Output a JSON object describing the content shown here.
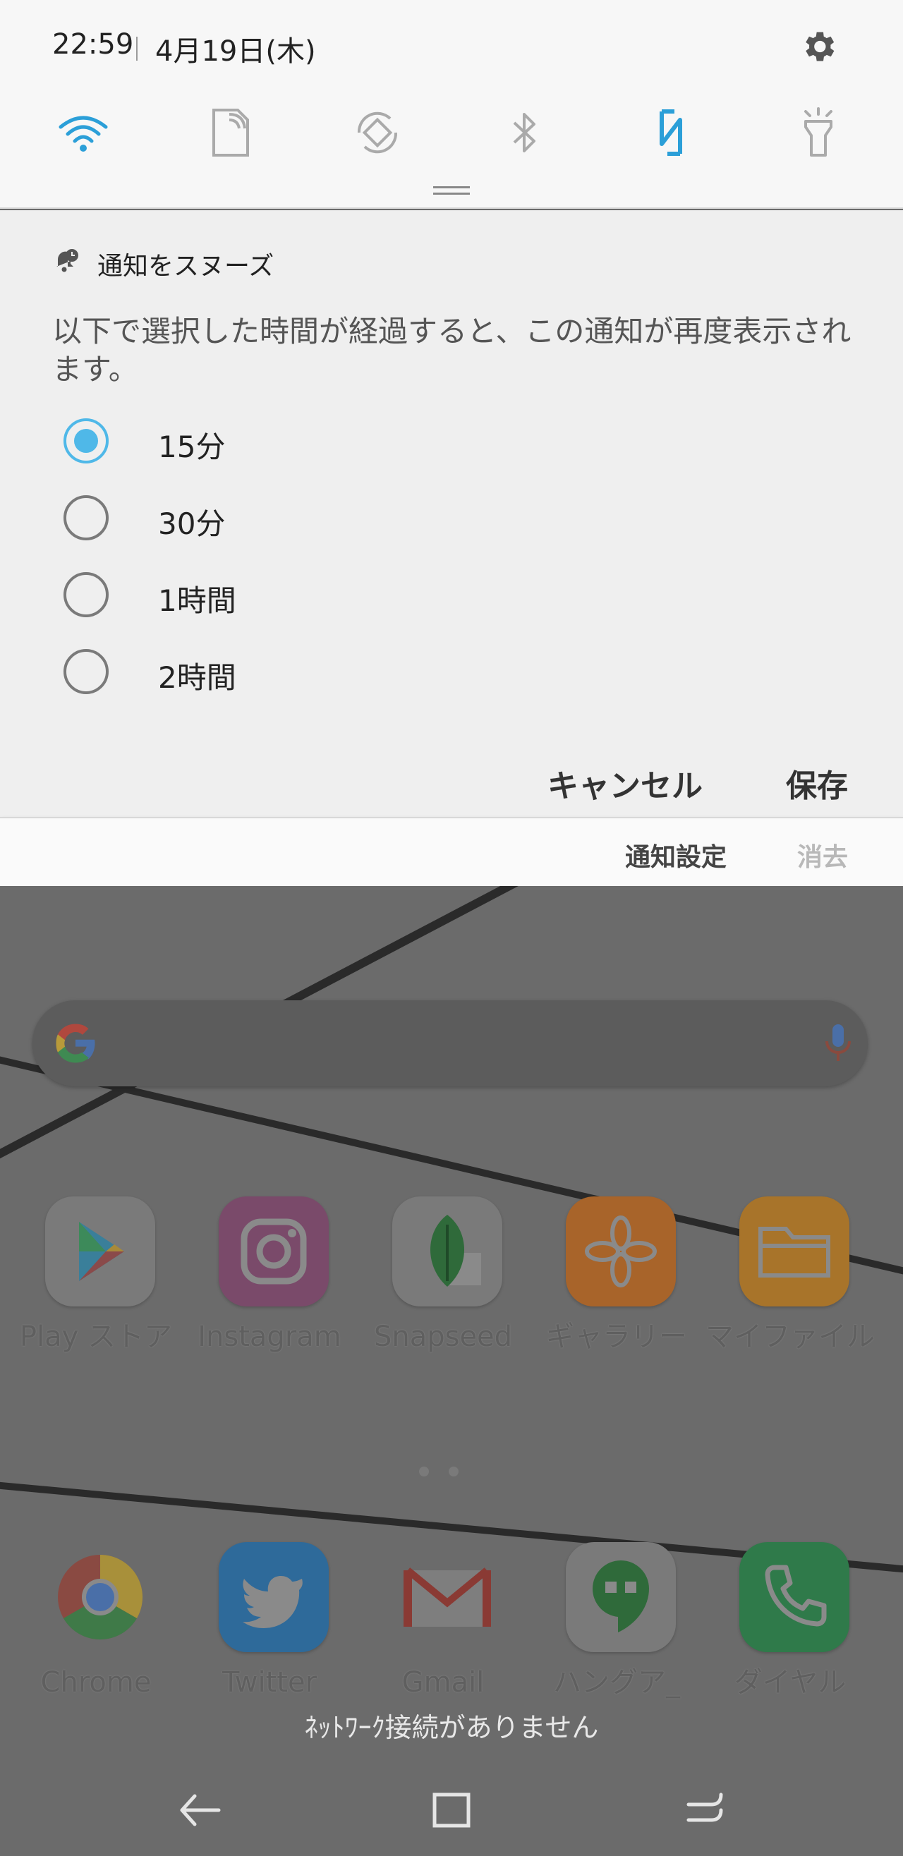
{
  "status": {
    "time": "22:59",
    "date": "4月19日(木)"
  },
  "quick_tiles": [
    {
      "name": "wifi-tile",
      "icon": "wifi-icon",
      "active": true
    },
    {
      "name": "mobile-data-tile",
      "icon": "sim-card-icon",
      "active": false
    },
    {
      "name": "auto-rotate-tile",
      "icon": "rotate-icon",
      "active": false
    },
    {
      "name": "bluetooth-tile",
      "icon": "bluetooth-icon",
      "active": false
    },
    {
      "name": "nfc-tile",
      "icon": "nfc-icon",
      "active": true
    },
    {
      "name": "flashlight-tile",
      "icon": "flashlight-icon",
      "active": false
    }
  ],
  "snooze": {
    "title": "通知をスヌーズ",
    "description": "以下で選択した時間が経過すると、この通知が再度表示されます。",
    "options": [
      {
        "label": "15分",
        "selected": true
      },
      {
        "label": "30分",
        "selected": false
      },
      {
        "label": "1時間",
        "selected": false
      },
      {
        "label": "2時間",
        "selected": false
      }
    ],
    "cancel_label": "キャンセル",
    "save_label": "保存"
  },
  "notification_footer": {
    "settings_label": "通知設定",
    "clear_label": "消去"
  },
  "home": {
    "apps_row1": [
      {
        "label": "Play ストア",
        "icon": "play-store-icon"
      },
      {
        "label": "Instagram",
        "icon": "instagram-icon"
      },
      {
        "label": "Snapseed",
        "icon": "snapseed-icon"
      },
      {
        "label": "ギャラリー",
        "icon": "gallery-icon"
      },
      {
        "label": "マイファイル",
        "icon": "my-files-icon"
      }
    ],
    "apps_row2": [
      {
        "label": "Chrome",
        "icon": "chrome-icon"
      },
      {
        "label": "Twitter",
        "icon": "twitter-icon"
      },
      {
        "label": "Gmail",
        "icon": "gmail-icon"
      },
      {
        "label": "ハングア_",
        "icon": "hangouts-icon"
      },
      {
        "label": "ダイヤル",
        "icon": "phone-icon"
      }
    ],
    "toast": "ﾈｯﾄﾜｰｸ接続がありません"
  },
  "colors": {
    "accent": "#4fb8e8",
    "panel": "#f7f7f7",
    "card": "#efefef",
    "scrim": "#6b6b6b"
  }
}
